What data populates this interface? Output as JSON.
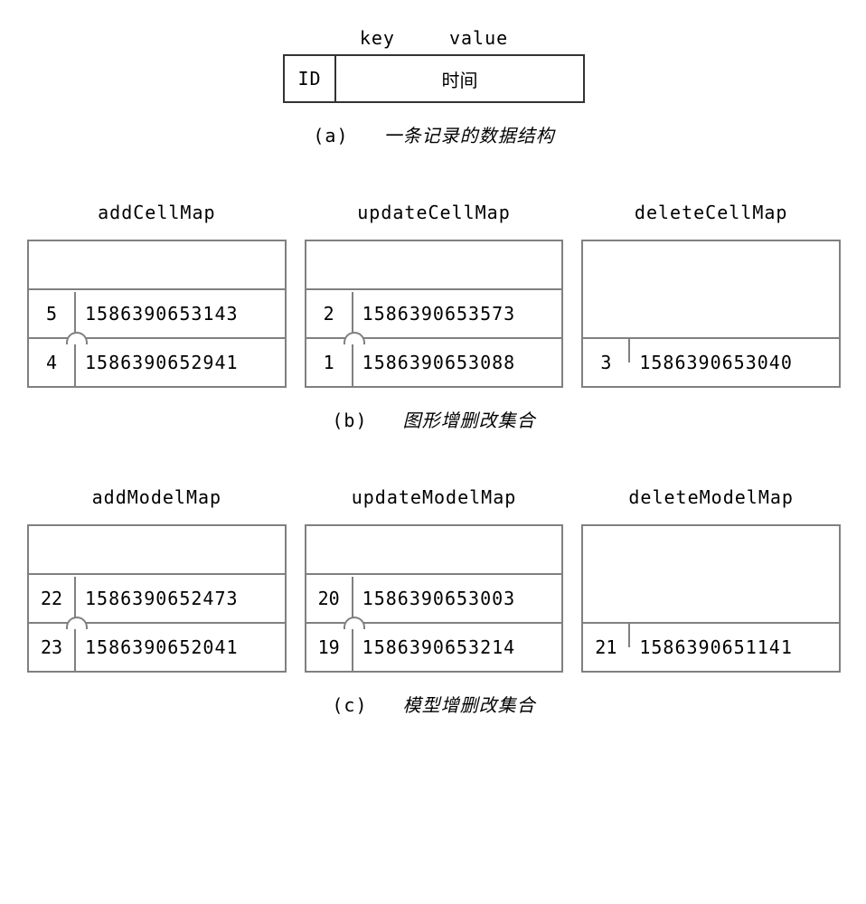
{
  "section_a": {
    "key_label": "key",
    "value_label": "value",
    "id_label": "ID",
    "value_text": "时间",
    "caption_prefix": "(a)",
    "caption_text": "一条记录的数据结构"
  },
  "section_b": {
    "caption_prefix": "(b)",
    "caption_text": "图形增删改集合",
    "maps": {
      "add": {
        "title": "addCellMap",
        "entries": [
          {
            "id": "5",
            "ts": "1586390653143"
          },
          {
            "id": "4",
            "ts": "1586390652941"
          }
        ]
      },
      "update": {
        "title": "updateCellMap",
        "entries": [
          {
            "id": "2",
            "ts": "1586390653573"
          },
          {
            "id": "1",
            "ts": "1586390653088"
          }
        ]
      },
      "delete": {
        "title": "deleteCellMap",
        "entries": [
          {
            "id": "3",
            "ts": "1586390653040"
          }
        ]
      }
    }
  },
  "section_c": {
    "caption_prefix": "(c)",
    "caption_text": "模型增删改集合",
    "maps": {
      "add": {
        "title": "addModelMap",
        "entries": [
          {
            "id": "22",
            "ts": "1586390652473"
          },
          {
            "id": "23",
            "ts": "1586390652041"
          }
        ]
      },
      "update": {
        "title": "updateModelMap",
        "entries": [
          {
            "id": "20",
            "ts": "1586390653003"
          },
          {
            "id": "19",
            "ts": "1586390653214"
          }
        ]
      },
      "delete": {
        "title": "deleteModelMap",
        "entries": [
          {
            "id": "21",
            "ts": "1586390651141"
          }
        ]
      }
    }
  }
}
